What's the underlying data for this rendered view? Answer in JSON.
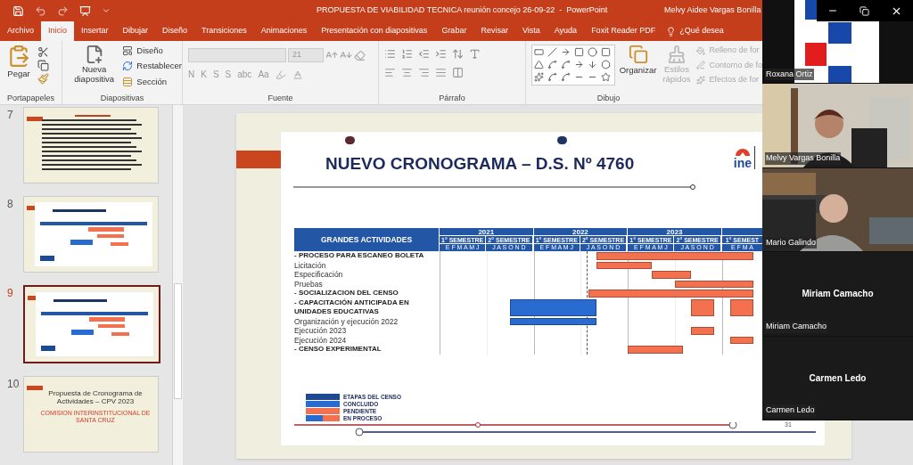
{
  "title_bar": {
    "document_title": "PROPUESTA DE VIABILIDAD TECNICA reunión concejo 26-09-22  -  PowerPoint",
    "user": "Melvy Aidee Vargas Bonilla"
  },
  "ribbon_tabs": [
    {
      "label": "Archivo",
      "selected": false
    },
    {
      "label": "Inicio",
      "selected": true
    },
    {
      "label": "Insertar",
      "selected": false
    },
    {
      "label": "Dibujar",
      "selected": false
    },
    {
      "label": "Diseño",
      "selected": false
    },
    {
      "label": "Transiciones",
      "selected": false
    },
    {
      "label": "Animaciones",
      "selected": false
    },
    {
      "label": "Presentación con diapositivas",
      "selected": false
    },
    {
      "label": "Grabar",
      "selected": false
    },
    {
      "label": "Revisar",
      "selected": false
    },
    {
      "label": "Vista",
      "selected": false
    },
    {
      "label": "Ayuda",
      "selected": false
    },
    {
      "label": "Foxit Reader PDF",
      "selected": false
    }
  ],
  "tell_me": "¿Qué desea",
  "ribbon": {
    "clipboard": {
      "paste": "Pegar",
      "group": "Portapapeles"
    },
    "slides": {
      "new_slide": "Nueva diapositiva",
      "layout": "Diseño",
      "reset": "Restablecer",
      "section": "Sección",
      "group": "Diapositivas"
    },
    "font": {
      "font_size": "21",
      "format_buttons": [
        "N",
        "K",
        "S",
        "S",
        "abc",
        "Aa"
      ],
      "group": "Fuente"
    },
    "paragraph": {
      "group": "Párrafo"
    },
    "drawing": {
      "arrange": "Organizar",
      "quick_styles": "Estilos rápidos",
      "shape_fill": "Relleno de for",
      "shape_outline": "Contorno de fo",
      "shape_effects": "Efectos de for",
      "group": "Dibujo"
    }
  },
  "thumbnails": [
    {
      "number": "7",
      "selected": false,
      "kind": "text"
    },
    {
      "number": "8",
      "selected": false,
      "kind": "gantt"
    },
    {
      "number": "9",
      "selected": true,
      "kind": "gantt"
    },
    {
      "number": "10",
      "selected": false,
      "kind": "title",
      "title": "Propuesta de Cronograma de Actividades – CPV 2023",
      "subtitle": "COMISION INTERINSTITUCIONAL DE SANTA CRUZ"
    }
  ],
  "slide": {
    "title": "NUEVO CRONOGRAMA – D.S. Nº 4760",
    "logo": "ine",
    "page_number": "31",
    "gantt": {
      "header": "GRANDES ACTIVIDADES",
      "years": [
        {
          "label": "2021",
          "semesters": [
            {
              "label": "1° SEMESTRE",
              "months": "E F M A M J"
            },
            {
              "label": "2° SEMESTRE",
              "months": "J A S O N D"
            }
          ]
        },
        {
          "label": "2022",
          "semesters": [
            {
              "label": "1° SEMESTRE",
              "months": "E F M A M J"
            },
            {
              "label": "2° SEMESTRE",
              "months": "J A S O N D"
            }
          ]
        },
        {
          "label": "2023",
          "semesters": [
            {
              "label": "1° SEMESTRE",
              "months": "E F M A M J"
            },
            {
              "label": "2° SEMESTRE",
              "months": "J A S O N D"
            }
          ]
        },
        {
          "semesters": [
            {
              "label": "1° SEMEST",
              "months": "E F M A"
            }
          ]
        }
      ],
      "rows": [
        {
          "label": "- PROCESO PARA ESCANEO BOLETA",
          "kind": "heading",
          "cells": [
            {
              "kind": "empty"
            },
            {
              "kind": "empty"
            },
            {
              "kind": "empty"
            },
            {
              "kind": "empty"
            },
            {
              "kind": "empty"
            },
            {
              "kind": "empty"
            },
            {
              "kind": "empty"
            },
            {
              "kind": "empty"
            },
            {
              "kind": "empty"
            },
            {
              "kind": "empty"
            },
            {
              "kind": "empty"
            },
            {
              "kind": "empty"
            },
            {
              "kind": "empty"
            },
            {
              "kind": "empty"
            },
            {
              "kind": "empty"
            },
            {
              "kind": "empty"
            },
            {
              "kind": "empty"
            },
            {
              "kind": "empty"
            },
            {
              "kind": "empty"
            },
            {
              "kind": "empty"
            },
            {
              "kind": "pending"
            },
            {
              "kind": "pending"
            },
            {
              "kind": "pending"
            },
            {
              "kind": "pending"
            },
            {
              "kind": "pending"
            },
            {
              "kind": "pending"
            },
            {
              "kind": "pending"
            },
            {
              "kind": "pending"
            },
            {
              "kind": "pending"
            },
            {
              "kind": "pending"
            },
            {
              "kind": "pending"
            },
            {
              "kind": "pending"
            },
            {
              "kind": "pending"
            },
            {
              "kind": "pending"
            },
            {
              "kind": "pending"
            },
            {
              "kind": "pending"
            },
            {
              "kind": "pending"
            },
            {
              "kind": "pending"
            },
            {
              "kind": "pending"
            },
            {
              "kind": "pending"
            }
          ]
        },
        {
          "label": "Licitación",
          "kind": "task",
          "cells": [
            {
              "kind": "empty"
            },
            {
              "kind": "empty"
            },
            {
              "kind": "empty"
            },
            {
              "kind": "empty"
            },
            {
              "kind": "empty"
            },
            {
              "kind": "empty"
            },
            {
              "kind": "empty"
            },
            {
              "kind": "empty"
            },
            {
              "kind": "empty"
            },
            {
              "kind": "empty"
            },
            {
              "kind": "empty"
            },
            {
              "kind": "empty"
            },
            {
              "kind": "empty"
            },
            {
              "kind": "empty"
            },
            {
              "kind": "empty"
            },
            {
              "kind": "empty"
            },
            {
              "kind": "empty"
            },
            {
              "kind": "empty"
            },
            {
              "kind": "empty"
            },
            {
              "kind": "empty"
            },
            {
              "kind": "pending"
            },
            {
              "kind": "pending"
            },
            {
              "kind": "pending"
            },
            {
              "kind": "pending"
            },
            {
              "kind": "pending"
            },
            {
              "kind": "pending"
            },
            {
              "kind": "pending"
            }
          ]
        },
        {
          "label": "Especificación",
          "kind": "task",
          "cells": [
            {
              "kind": "empty"
            },
            {
              "kind": "empty"
            },
            {
              "kind": "empty"
            },
            {
              "kind": "empty"
            },
            {
              "kind": "empty"
            },
            {
              "kind": "empty"
            },
            {
              "kind": "empty"
            },
            {
              "kind": "empty"
            },
            {
              "kind": "empty"
            },
            {
              "kind": "empty"
            },
            {
              "kind": "empty"
            },
            {
              "kind": "empty"
            },
            {
              "kind": "empty"
            },
            {
              "kind": "empty"
            },
            {
              "kind": "empty"
            },
            {
              "kind": "empty"
            },
            {
              "kind": "empty"
            },
            {
              "kind": "empty"
            },
            {
              "kind": "empty"
            },
            {
              "kind": "empty"
            },
            {
              "kind": "empty"
            },
            {
              "kind": "empty"
            },
            {
              "kind": "empty"
            },
            {
              "kind": "empty"
            },
            {
              "kind": "empty"
            },
            {
              "kind": "empty"
            },
            {
              "kind": "empty"
            },
            {
              "kind": "pending"
            },
            {
              "kind": "pending"
            },
            {
              "kind": "pending"
            },
            {
              "kind": "pending"
            },
            {
              "kind": "pending"
            }
          ]
        },
        {
          "label": "Pruebas",
          "kind": "task",
          "cells": [
            {
              "kind": "empty"
            },
            {
              "kind": "empty"
            },
            {
              "kind": "empty"
            },
            {
              "kind": "empty"
            },
            {
              "kind": "empty"
            },
            {
              "kind": "empty"
            },
            {
              "kind": "empty"
            },
            {
              "kind": "empty"
            },
            {
              "kind": "empty"
            },
            {
              "kind": "empty"
            },
            {
              "kind": "empty"
            },
            {
              "kind": "empty"
            },
            {
              "kind": "empty"
            },
            {
              "kind": "empty"
            },
            {
              "kind": "empty"
            },
            {
              "kind": "empty"
            },
            {
              "kind": "empty"
            },
            {
              "kind": "empty"
            },
            {
              "kind": "empty"
            },
            {
              "kind": "empty"
            },
            {
              "kind": "empty"
            },
            {
              "kind": "empty"
            },
            {
              "kind": "empty"
            },
            {
              "kind": "empty"
            },
            {
              "kind": "empty"
            },
            {
              "kind": "empty"
            },
            {
              "kind": "empty"
            },
            {
              "kind": "empty"
            },
            {
              "kind": "empty"
            },
            {
              "kind": "empty"
            },
            {
              "kind": "pending"
            },
            {
              "kind": "pending"
            },
            {
              "kind": "pending"
            },
            {
              "kind": "pending"
            },
            {
              "kind": "pending"
            },
            {
              "kind": "pending"
            },
            {
              "kind": "pending"
            },
            {
              "kind": "pending"
            },
            {
              "kind": "pending"
            },
            {
              "kind": "pending"
            }
          ]
        },
        {
          "label": "- SOCIALIZACION DEL CENSO",
          "kind": "heading",
          "cells": [
            {
              "kind": "empty"
            },
            {
              "kind": "empty"
            },
            {
              "kind": "empty"
            },
            {
              "kind": "empty"
            },
            {
              "kind": "empty"
            },
            {
              "kind": "empty"
            },
            {
              "kind": "empty"
            },
            {
              "kind": "empty"
            },
            {
              "kind": "empty"
            },
            {
              "kind": "empty"
            },
            {
              "kind": "empty"
            },
            {
              "kind": "empty"
            },
            {
              "kind": "empty"
            },
            {
              "kind": "empty"
            },
            {
              "kind": "empty"
            },
            {
              "kind": "empty"
            },
            {
              "kind": "empty"
            },
            {
              "kind": "empty"
            },
            {
              "kind": "empty"
            },
            {
              "kind": "pending"
            },
            {
              "kind": "pending"
            },
            {
              "kind": "pending"
            },
            {
              "kind": "pending"
            },
            {
              "kind": "pending"
            },
            {
              "kind": "pending"
            },
            {
              "kind": "pending"
            },
            {
              "kind": "pending"
            },
            {
              "kind": "pending"
            },
            {
              "kind": "pending"
            },
            {
              "kind": "pending"
            },
            {
              "kind": "pending"
            },
            {
              "kind": "pending"
            },
            {
              "kind": "pending"
            },
            {
              "kind": "pending"
            },
            {
              "kind": "pending"
            },
            {
              "kind": "pending"
            },
            {
              "kind": "pending"
            },
            {
              "kind": "pending"
            },
            {
              "kind": "pending"
            },
            {
              "kind": "pending"
            }
          ]
        },
        {
          "label": "- CAPACITACIÓN ANTICIPADA EN UNIDADES EDUCATIVAS",
          "kind": "heading",
          "cells": [
            {
              "kind": "empty"
            },
            {
              "kind": "empty"
            },
            {
              "kind": "empty"
            },
            {
              "kind": "empty"
            },
            {
              "kind": "empty"
            },
            {
              "kind": "empty"
            },
            {
              "kind": "empty"
            },
            {
              "kind": "empty"
            },
            {
              "kind": "empty"
            },
            {
              "kind": "done"
            },
            {
              "kind": "done"
            },
            {
              "kind": "done"
            },
            {
              "kind": "done"
            },
            {
              "kind": "done"
            },
            {
              "kind": "done"
            },
            {
              "kind": "done"
            },
            {
              "kind": "done"
            },
            {
              "kind": "done"
            },
            {
              "kind": "done"
            },
            {
              "kind": "done"
            },
            {
              "kind": "empty"
            },
            {
              "kind": "empty"
            },
            {
              "kind": "empty"
            },
            {
              "kind": "empty"
            },
            {
              "kind": "empty"
            },
            {
              "kind": "empty"
            },
            {
              "kind": "empty"
            },
            {
              "kind": "empty"
            },
            {
              "kind": "empty"
            },
            {
              "kind": "empty"
            },
            {
              "kind": "empty"
            },
            {
              "kind": "empty"
            },
            {
              "kind": "pending"
            },
            {
              "kind": "pending"
            },
            {
              "kind": "pending"
            },
            {
              "kind": "empty"
            },
            {
              "kind": "empty"
            },
            {
              "kind": "pending"
            },
            {
              "kind": "pending"
            },
            {
              "kind": "pending"
            }
          ]
        },
        {
          "label": "Organización y ejecución 2022",
          "kind": "task",
          "cells": [
            {
              "kind": "empty"
            },
            {
              "kind": "empty"
            },
            {
              "kind": "empty"
            },
            {
              "kind": "empty"
            },
            {
              "kind": "empty"
            },
            {
              "kind": "empty"
            },
            {
              "kind": "empty"
            },
            {
              "kind": "empty"
            },
            {
              "kind": "empty"
            },
            {
              "kind": "done"
            },
            {
              "kind": "done"
            },
            {
              "kind": "done"
            },
            {
              "kind": "done"
            },
            {
              "kind": "done"
            },
            {
              "kind": "done"
            },
            {
              "kind": "done"
            },
            {
              "kind": "done"
            },
            {
              "kind": "done"
            },
            {
              "kind": "done"
            },
            {
              "kind": "done"
            }
          ]
        },
        {
          "label": "Ejecución 2023",
          "kind": "task",
          "cells": [
            {
              "kind": "empty"
            },
            {
              "kind": "empty"
            },
            {
              "kind": "empty"
            },
            {
              "kind": "empty"
            },
            {
              "kind": "empty"
            },
            {
              "kind": "empty"
            },
            {
              "kind": "empty"
            },
            {
              "kind": "empty"
            },
            {
              "kind": "empty"
            },
            {
              "kind": "empty"
            },
            {
              "kind": "empty"
            },
            {
              "kind": "empty"
            },
            {
              "kind": "empty"
            },
            {
              "kind": "empty"
            },
            {
              "kind": "empty"
            },
            {
              "kind": "empty"
            },
            {
              "kind": "empty"
            },
            {
              "kind": "empty"
            },
            {
              "kind": "empty"
            },
            {
              "kind": "empty"
            },
            {
              "kind": "empty"
            },
            {
              "kind": "empty"
            },
            {
              "kind": "empty"
            },
            {
              "kind": "empty"
            },
            {
              "kind": "empty"
            },
            {
              "kind": "empty"
            },
            {
              "kind": "empty"
            },
            {
              "kind": "empty"
            },
            {
              "kind": "empty"
            },
            {
              "kind": "empty"
            },
            {
              "kind": "empty"
            },
            {
              "kind": "empty"
            },
            {
              "kind": "pending"
            },
            {
              "kind": "pending"
            },
            {
              "kind": "pending"
            }
          ]
        },
        {
          "label": "Ejecución 2024",
          "kind": "task",
          "cells": [
            {
              "kind": "empty"
            },
            {
              "kind": "empty"
            },
            {
              "kind": "empty"
            },
            {
              "kind": "empty"
            },
            {
              "kind": "empty"
            },
            {
              "kind": "empty"
            },
            {
              "kind": "empty"
            },
            {
              "kind": "empty"
            },
            {
              "kind": "empty"
            },
            {
              "kind": "empty"
            },
            {
              "kind": "empty"
            },
            {
              "kind": "empty"
            },
            {
              "kind": "empty"
            },
            {
              "kind": "empty"
            },
            {
              "kind": "empty"
            },
            {
              "kind": "empty"
            },
            {
              "kind": "empty"
            },
            {
              "kind": "empty"
            },
            {
              "kind": "empty"
            },
            {
              "kind": "empty"
            },
            {
              "kind": "empty"
            },
            {
              "kind": "empty"
            },
            {
              "kind": "empty"
            },
            {
              "kind": "empty"
            },
            {
              "kind": "empty"
            },
            {
              "kind": "empty"
            },
            {
              "kind": "empty"
            },
            {
              "kind": "empty"
            },
            {
              "kind": "empty"
            },
            {
              "kind": "empty"
            },
            {
              "kind": "empty"
            },
            {
              "kind": "empty"
            },
            {
              "kind": "empty"
            },
            {
              "kind": "empty"
            },
            {
              "kind": "empty"
            },
            {
              "kind": "empty"
            },
            {
              "kind": "empty"
            },
            {
              "kind": "pending"
            },
            {
              "kind": "pending"
            },
            {
              "kind": "pending"
            }
          ]
        },
        {
          "label": "- CENSO EXPERIMENTAL",
          "kind": "heading",
          "cells": [
            {
              "kind": "empty"
            },
            {
              "kind": "empty"
            },
            {
              "kind": "empty"
            },
            {
              "kind": "empty"
            },
            {
              "kind": "empty"
            },
            {
              "kind": "empty"
            },
            {
              "kind": "empty"
            },
            {
              "kind": "empty"
            },
            {
              "kind": "empty"
            },
            {
              "kind": "empty"
            },
            {
              "kind": "empty"
            },
            {
              "kind": "empty"
            },
            {
              "kind": "empty"
            },
            {
              "kind": "empty"
            },
            {
              "kind": "empty"
            },
            {
              "kind": "empty"
            },
            {
              "kind": "empty"
            },
            {
              "kind": "empty"
            },
            {
              "kind": "empty"
            },
            {
              "kind": "empty"
            },
            {
              "kind": "empty"
            },
            {
              "kind": "empty"
            },
            {
              "kind": "empty"
            },
            {
              "kind": "empty"
            },
            {
              "kind": "pending"
            },
            {
              "kind": "pending"
            },
            {
              "kind": "pending"
            },
            {
              "kind": "pending"
            },
            {
              "kind": "pending"
            },
            {
              "kind": "pending"
            },
            {
              "kind": "pending"
            }
          ]
        }
      ]
    },
    "legend": [
      {
        "label": "ETAPAS DEL CENSO",
        "kind": "solid",
        "color": "#1d4a94"
      },
      {
        "label": "CONCLUIDO",
        "kind": "solid",
        "color": "#2a6bd1"
      },
      {
        "label": "PENDIENTE",
        "kind": "solid",
        "color": "#f3714f"
      },
      {
        "label": "EN PROCESO",
        "kind": "split"
      }
    ]
  },
  "video_tiles": [
    {
      "kind": "screen",
      "name": "Roxana Ortiz"
    },
    {
      "kind": "video",
      "name": "Melvy Vargas Bonilla"
    },
    {
      "kind": "video",
      "name": "Mario Galindo"
    },
    {
      "kind": "avatar",
      "display_name": "Miriam Camacho",
      "name": "Miriam Camacho"
    },
    {
      "kind": "avatar",
      "display_name": "Carmen Ledo",
      "name": "Carmen Ledo"
    }
  ]
}
